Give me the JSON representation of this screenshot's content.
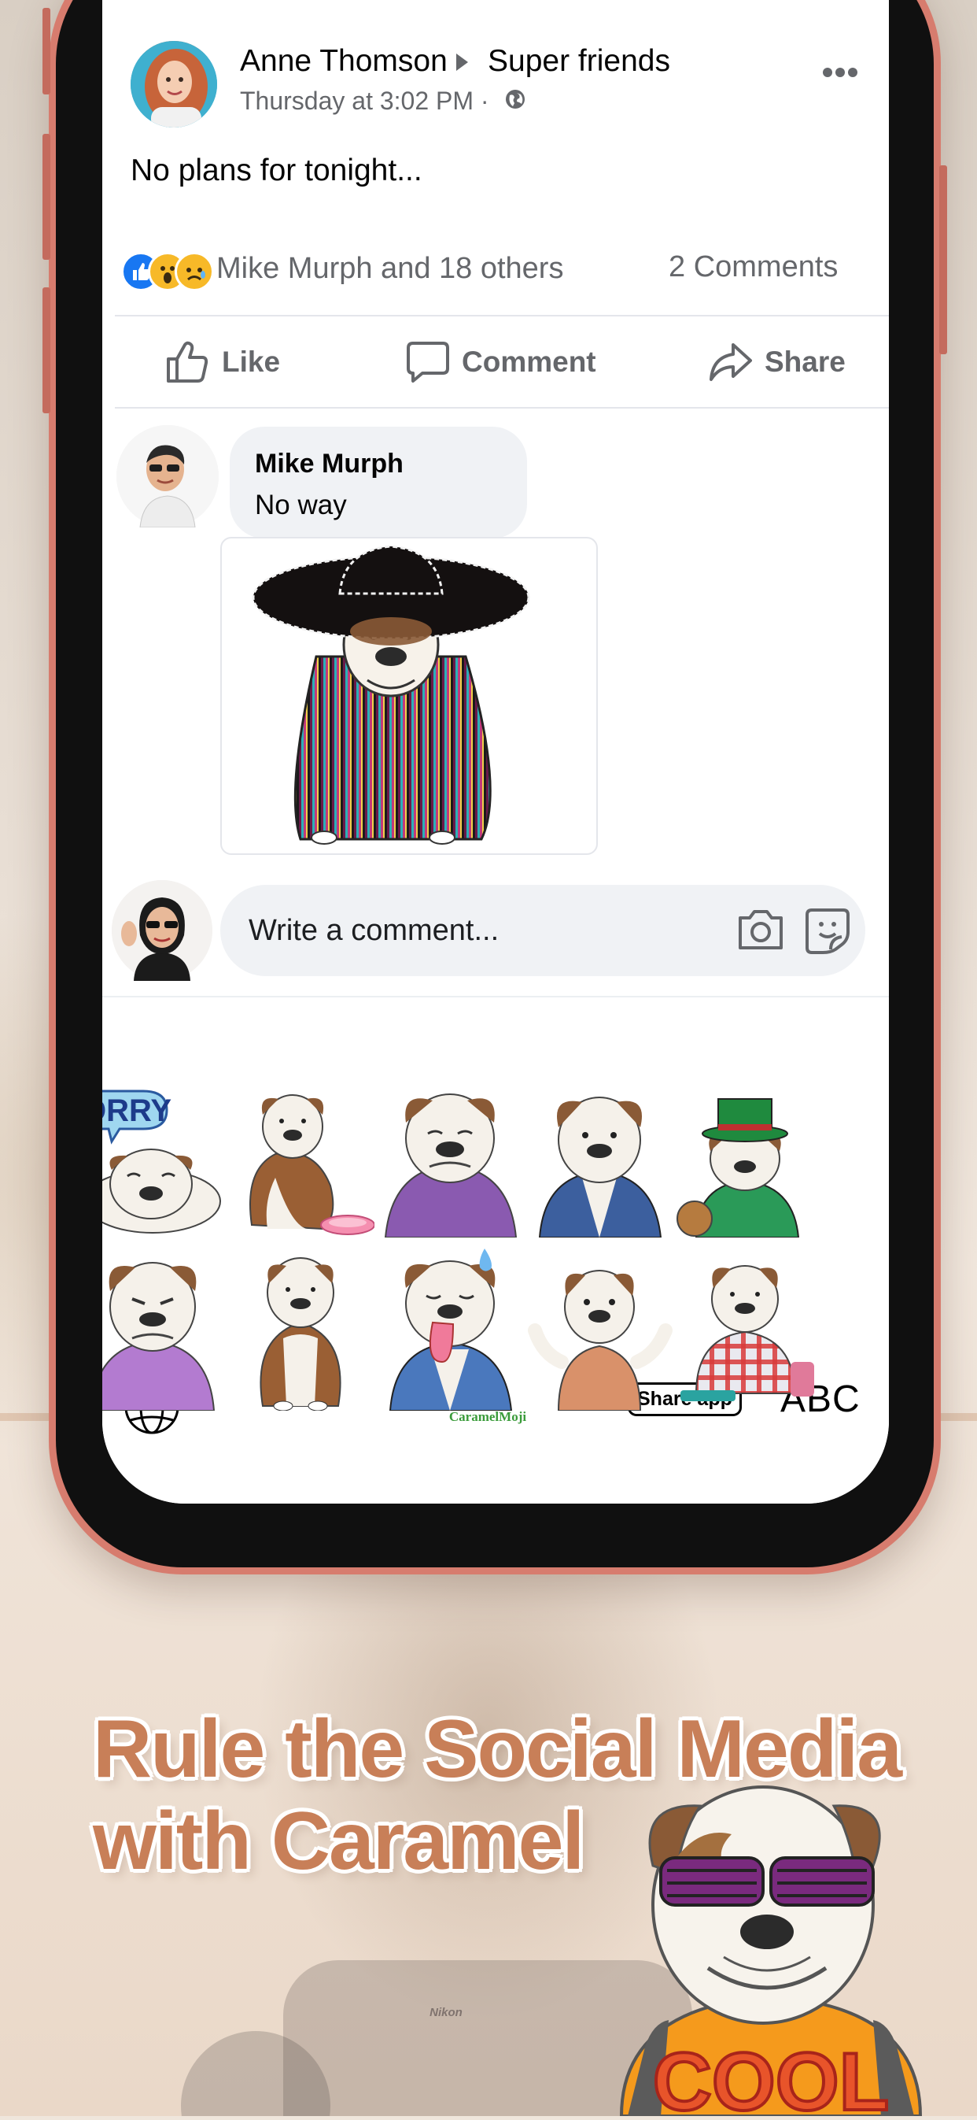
{
  "app": {
    "logo": "facebook",
    "header_icons": [
      "search-icon",
      "messenger-icon"
    ]
  },
  "post": {
    "author": "Anne Thomson",
    "group": "Super friends",
    "timestamp": "Thursday at 3:02 PM ·",
    "privacy_icon": "globe-icon",
    "text": "No plans for tonight...",
    "reactions": [
      "like",
      "wow",
      "sad"
    ],
    "reaction_summary": "Mike Murph and 18 others",
    "comment_count": "2 Comments",
    "actions": {
      "like": "Like",
      "comment": "Comment",
      "share": "Share"
    }
  },
  "comment": {
    "author": "Mike Murph",
    "text": "No way",
    "sticker": "bulldog-sombrero-poncho-sticker"
  },
  "composer": {
    "placeholder": "Write a comment...",
    "icons": [
      "camera-icon",
      "sticker-icon"
    ]
  },
  "keyboard": {
    "sticker_grid": [
      [
        "bulldog-sorry",
        "bulldog-bowl",
        "bulldog-purple-hoodie",
        "bulldog-vest",
        "bulldog-green-hat"
      ],
      [
        "bulldog-pink-shirt",
        "bulldog-sitting",
        "bulldog-sweat-tongue",
        "bulldog-shrug",
        "bulldog-plaid-shirt"
      ]
    ],
    "sorry_text": "ORRY",
    "brand": "CaramelMoji",
    "share_label": "Share app",
    "abc_label": "ABC"
  },
  "marketing": {
    "line1": "Rule the Social Media",
    "line2": "with Caramel",
    "dog_shirt_text": "COOL"
  },
  "background": {
    "camera_text": "Nikon"
  },
  "colors": {
    "facebook_blue": "#1877f2",
    "phone_frame": "#d77c6e",
    "headline": "#c87f58"
  }
}
